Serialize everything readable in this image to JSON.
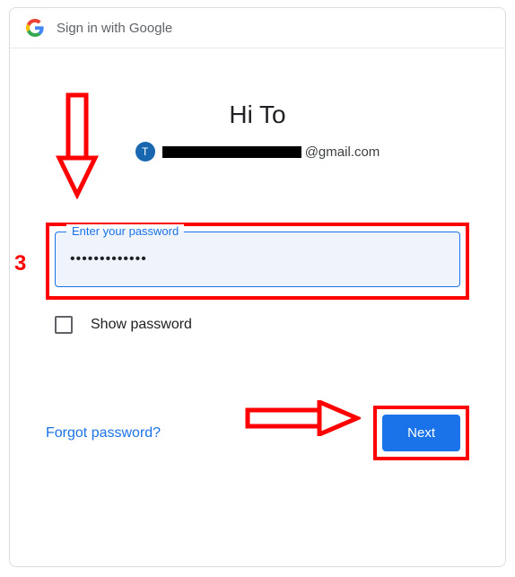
{
  "header": {
    "title": "Sign in with Google"
  },
  "greeting": "Hi To",
  "account": {
    "avatar_initial": "T",
    "email_domain": "@gmail.com"
  },
  "password_field": {
    "label": "Enter your password",
    "value": "•••••••••••••"
  },
  "show_password": {
    "label": "Show password"
  },
  "actions": {
    "forgot": "Forgot password?",
    "next": "Next"
  },
  "annotations": {
    "step_number": "3"
  }
}
